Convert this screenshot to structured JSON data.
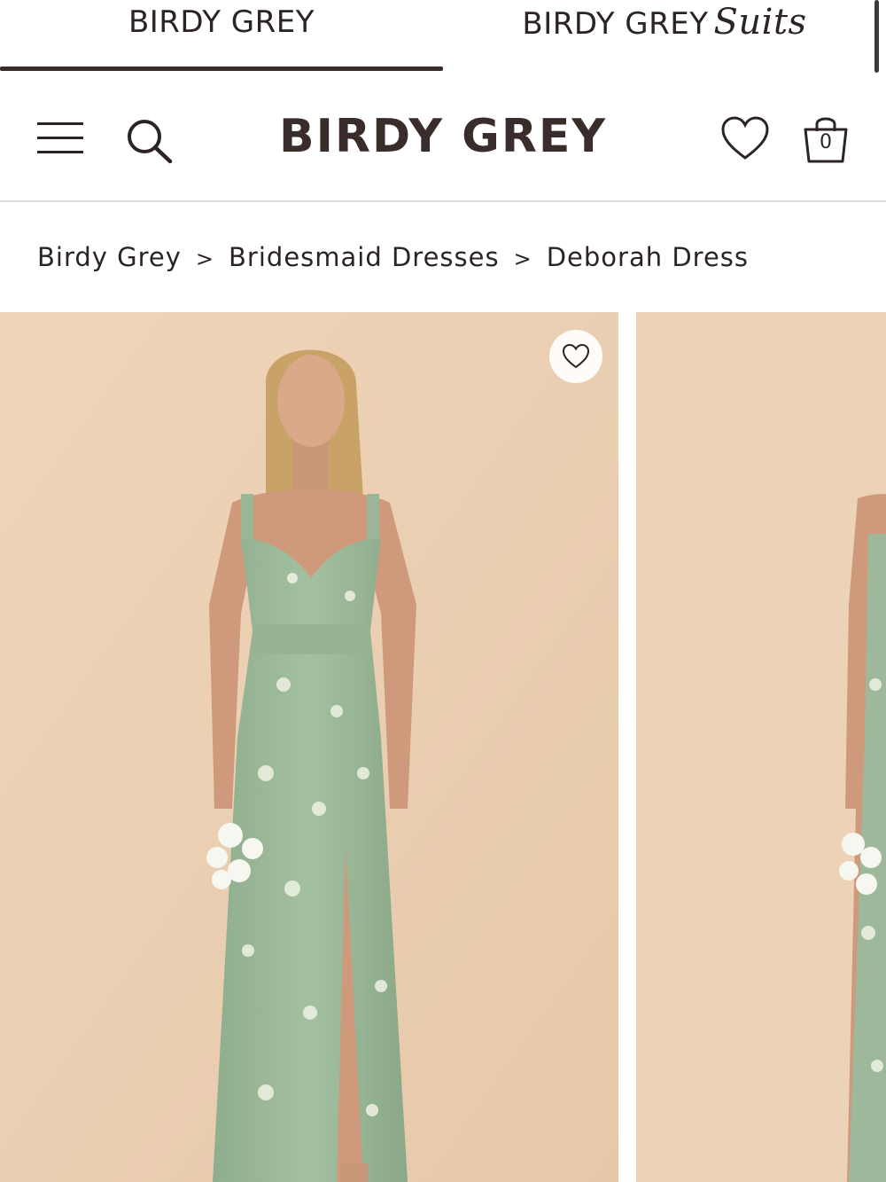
{
  "brand_tabs": [
    {
      "label": "BIRDY GREY",
      "active": true
    },
    {
      "label": "BIRDY GREY",
      "suffix": "Suits",
      "active": false
    }
  ],
  "header": {
    "logo": "BIRDY GREY",
    "menu_icon": "hamburger-menu-icon",
    "search_icon": "search-icon",
    "wishlist_icon": "heart-icon",
    "cart_icon": "shopping-bag-icon",
    "cart_count": "0"
  },
  "breadcrumb": {
    "items": [
      "Birdy Grey",
      "Bridesmaid Dresses",
      "Deborah Dress"
    ],
    "separator": ">"
  },
  "gallery": {
    "favorite_icon": "heart-icon",
    "images": [
      {
        "alt": "Deborah Dress front view"
      },
      {
        "alt": "Deborah Dress alternate view"
      }
    ]
  },
  "colors": {
    "text": "#2b2423",
    "accent": "#3a2c2a",
    "photo_background": "#ecd2b6",
    "dress": "#9db89a"
  }
}
